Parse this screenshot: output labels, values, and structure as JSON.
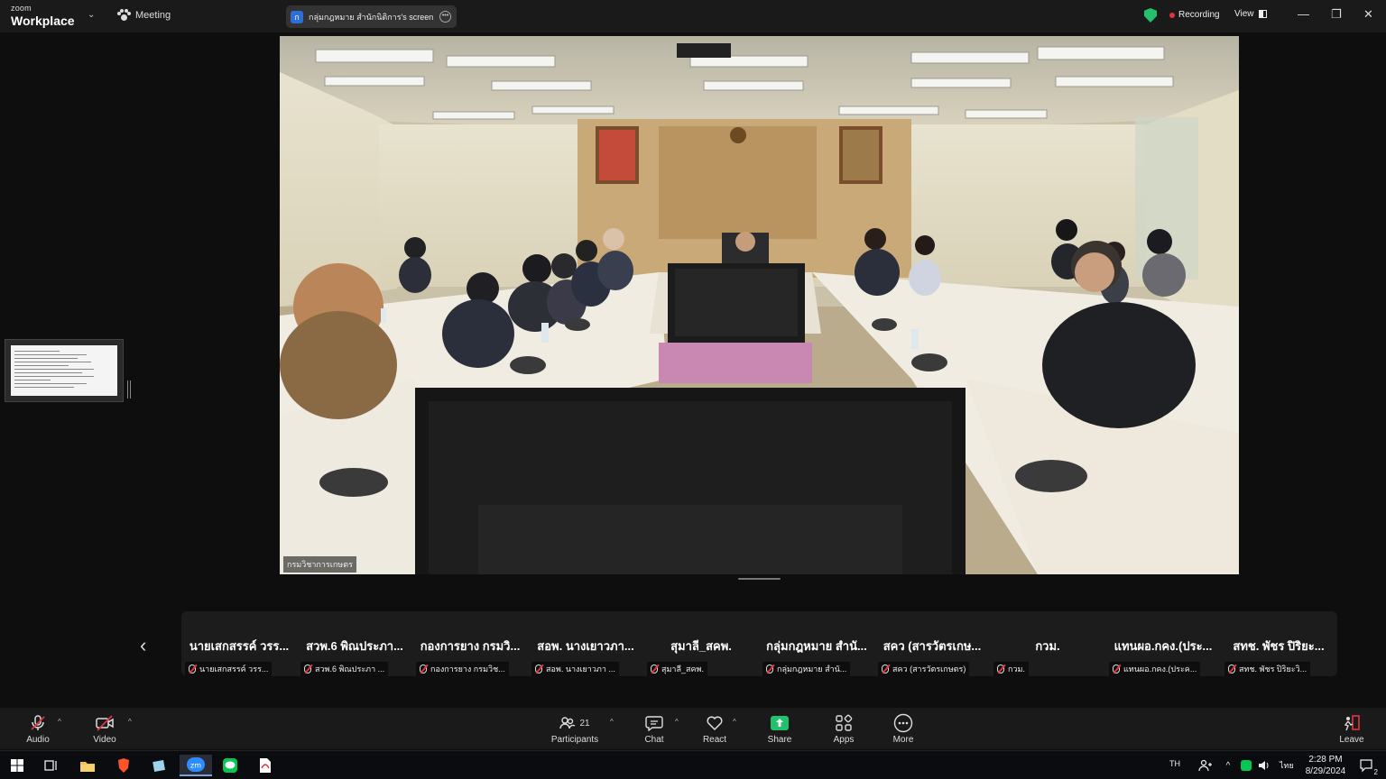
{
  "titlebar": {
    "brand_small": "zoom",
    "brand_big": "Workplace",
    "meeting_label": "Meeting",
    "share_avatar": "ก",
    "share_text": "กลุ่มกฎหมาย สำนักนิติการ's screen",
    "recording_label": "Recording",
    "view_label": "View"
  },
  "video": {
    "name_label": "กรมวิชาการเกษตร"
  },
  "participants": [
    {
      "big": "นายเสกสรรค์ วรร...",
      "small": "นายเสกสรรค์ วรร..."
    },
    {
      "big": "สวพ.6 พิณประภา...",
      "small": "สวพ.6 พิณประภา ..."
    },
    {
      "big": "กองการยาง กรมวิ...",
      "small": "กองการยาง กรมวิช..."
    },
    {
      "big": "สอพ. นางเยาวภา...",
      "small": "สอพ. นางเยาวภา ..."
    },
    {
      "big": "สุมาลี_สคพ.",
      "small": "สุมาลี_สคพ."
    },
    {
      "big": "กลุ่มกฎหมาย สำนั...",
      "small": "กลุ่มกฎหมาย สำนั..."
    },
    {
      "big": "สคว (สารวัตรเกษ...",
      "small": "สคว (สารวัตรเกษตร)"
    },
    {
      "big": "กวม.",
      "small": "กวม."
    },
    {
      "big": "แทนผอ.กคง.(ประ...",
      "small": "แทนผอ.กคง.(ประค..."
    },
    {
      "big": "สทช. พัชร ปิริยะ...",
      "small": "สทช. พัชร ปิริยะวิ..."
    }
  ],
  "toolbar": {
    "audio": "Audio",
    "video": "Video",
    "participants": "Participants",
    "participants_count": "21",
    "chat": "Chat",
    "react": "React",
    "share": "Share",
    "apps": "Apps",
    "more": "More",
    "leave": "Leave"
  },
  "taskbar": {
    "lang": "TH",
    "input_lang": "ไทย",
    "time": "2:28 PM",
    "date": "8/29/2024",
    "notifications": "2"
  },
  "colors": {
    "accent_green": "#23c16b",
    "recording_red": "#e0353f",
    "share_green": "#23c16b",
    "leave_red": "#e0353f"
  }
}
